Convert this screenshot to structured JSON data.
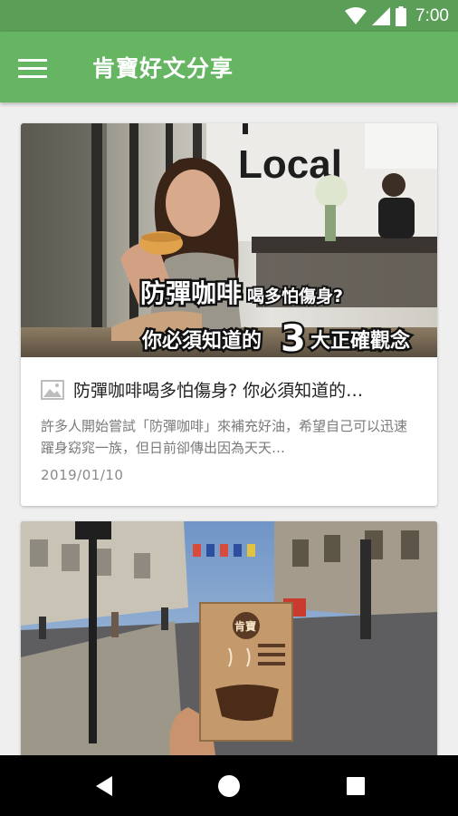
{
  "status_bar": {
    "time": "7:00"
  },
  "app_bar": {
    "title": "肯寶好文分享"
  },
  "articles": [
    {
      "title": "防彈咖啡喝多怕傷身? 你必須知道的…",
      "excerpt": "許多人開始嘗試「防彈咖啡」來補充好油，希望自己可以迅速躍身窈窕一族，但日前卻傳出因為天天…",
      "date": "2019/01/10",
      "image": {
        "shop_sign": "Local",
        "headline_line1_big": "防彈咖啡",
        "headline_line1_small": "喝多怕傷身?",
        "headline_line2_a": "你必須知道的",
        "headline_line2_num": "3",
        "headline_line2_b": "大正確觀念"
      }
    },
    {
      "image": {
        "package_brand": "肯寶"
      }
    }
  ],
  "colors": {
    "app_bar": "#66b563",
    "status_bar": "#5a9e58",
    "nav_bar": "#000000"
  }
}
